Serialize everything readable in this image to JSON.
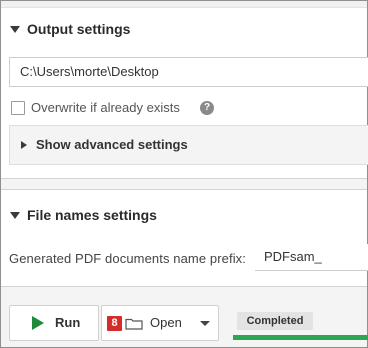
{
  "output_settings": {
    "title": "Output settings",
    "destination_value": "C:\\Users\\morte\\Desktop",
    "overwrite_label": "Overwrite if already exists",
    "overwrite_checked": false,
    "help_icon": "?",
    "advanced_label": "Show advanced settings"
  },
  "file_names_settings": {
    "title": "File names settings",
    "prefix_label": "Generated PDF documents name prefix:",
    "prefix_value": "PDFsam_"
  },
  "footer": {
    "run_label": "Run",
    "open_badge": "8",
    "open_label": "Open",
    "status_text": "Completed",
    "progress": 1.0,
    "progress_color": "#2ca653"
  }
}
